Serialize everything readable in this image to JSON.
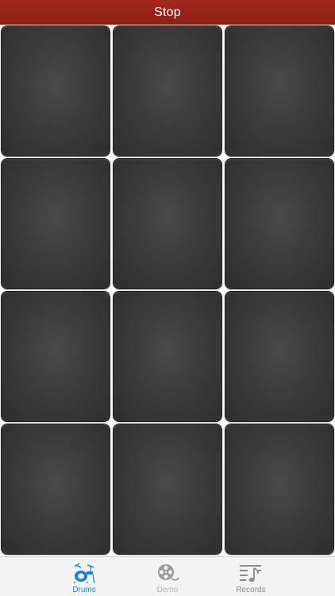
{
  "header": {
    "title": "Stop"
  },
  "pads": {
    "rows": 4,
    "columns": 3,
    "count": 12
  },
  "tab_bar": {
    "active_color": "#1a7fe0",
    "inactive_color": "#8a8a8a",
    "tabs": [
      {
        "label": "Drums",
        "icon": "drum-kit-icon",
        "active": true
      },
      {
        "label": "Demo",
        "icon": "film-reel-icon",
        "active": false
      },
      {
        "label": "Records",
        "icon": "music-list-icon",
        "active": false
      }
    ]
  },
  "colors": {
    "header_bg": "#9b2519",
    "pad_bg": "#3d3d3d",
    "tab_bar_bg": "#f3f3f3"
  }
}
